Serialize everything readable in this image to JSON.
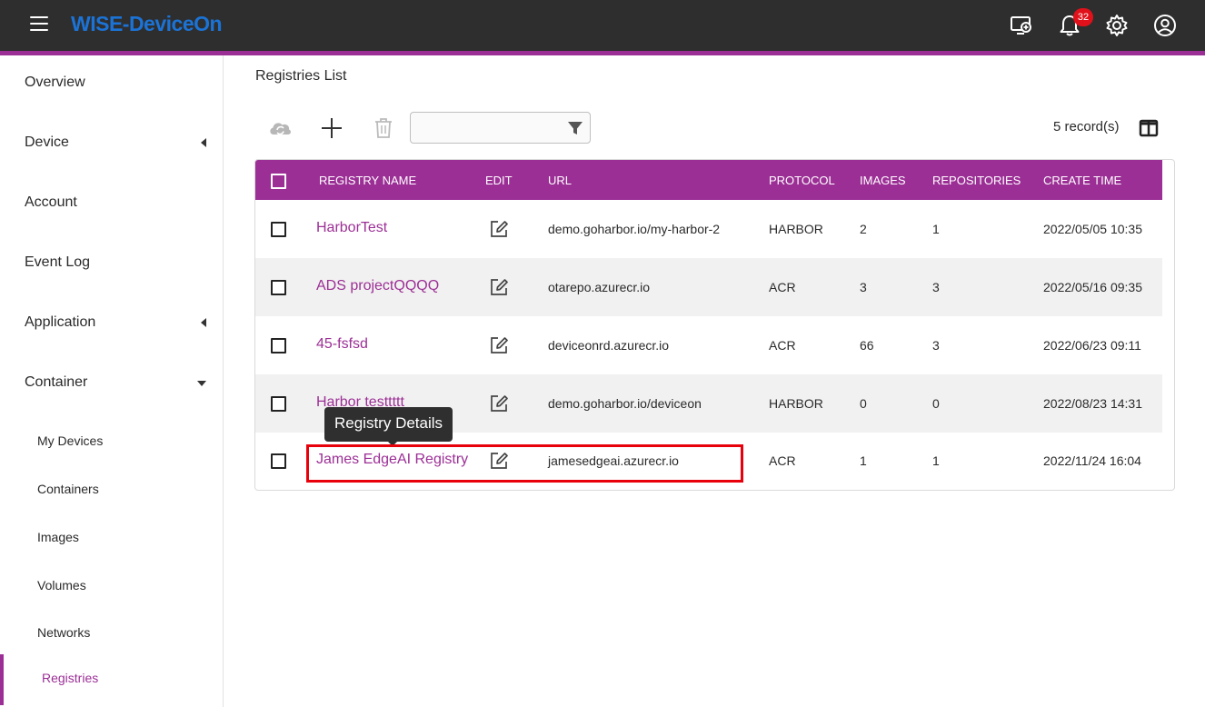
{
  "app": {
    "brand": "WISE-DeviceOn",
    "notification_count": "32",
    "accent_color": "#9c2f96",
    "brand_color": "#1b73d6"
  },
  "topbar_icons": [
    "remote-screen-icon",
    "bell-icon",
    "gear-icon",
    "account-circle-icon"
  ],
  "sidebar": {
    "items": [
      {
        "label": "Overview"
      },
      {
        "label": "Device"
      },
      {
        "label": "Account"
      },
      {
        "label": "Event Log"
      },
      {
        "label": "Application"
      },
      {
        "label": "Container"
      }
    ],
    "container_sub": [
      {
        "label": "My Devices"
      },
      {
        "label": "Containers"
      },
      {
        "label": "Images"
      },
      {
        "label": "Volumes"
      },
      {
        "label": "Networks"
      },
      {
        "label": "Registries"
      }
    ]
  },
  "main": {
    "title": "Registries List",
    "filter_placeholder": "",
    "records": "5 record(s)"
  },
  "table": {
    "headers": [
      "REGISTRY NAME",
      "EDIT",
      "URL",
      "PROTOCOL",
      "IMAGES",
      "REPOSITORIES",
      "CREATE TIME"
    ],
    "rows": [
      {
        "name": "HarborTest",
        "url": "demo.goharbor.io/my-harbor-2",
        "protocol": "HARBOR",
        "images": "2",
        "repos": "1",
        "created": "2022/05/05 10:35"
      },
      {
        "name": "ADS projectQQQQ",
        "url": "otarepo.azurecr.io",
        "protocol": "ACR",
        "images": "3",
        "repos": "3",
        "created": "2022/05/16 09:35"
      },
      {
        "name": "45-fsfsd",
        "url": "deviceonrd.azurecr.io",
        "protocol": "ACR",
        "images": "66",
        "repos": "3",
        "created": "2022/06/23 09:11"
      },
      {
        "name": "Harbor testtttt",
        "url": "demo.goharbor.io/deviceon",
        "protocol": "HARBOR",
        "images": "0",
        "repos": "0",
        "created": "2022/08/23 14:31"
      },
      {
        "name": "James EdgeAI Registry",
        "url": "jamesedgeai.azurecr.io",
        "protocol": "ACR",
        "images": "1",
        "repos": "1",
        "created": "2022/11/24 16:04"
      }
    ]
  },
  "tooltip": {
    "text": "Registry Details"
  }
}
